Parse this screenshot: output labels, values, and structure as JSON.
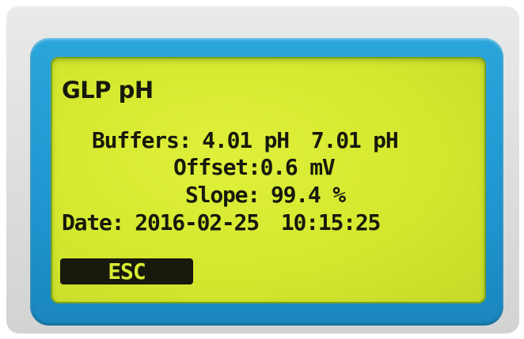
{
  "screen": {
    "title": "GLP pH",
    "buffers_label": "Buffers:",
    "buffer_1": "4.01 pH",
    "buffer_2": "7.01 pH",
    "offset_label": "Offset:",
    "offset_value": "0.6 mV",
    "slope_label": "Slope:",
    "slope_value": "99.4 %",
    "date_label": "Date:",
    "date_value": "2016-02-25",
    "time_value": "10:15:25"
  },
  "softkeys": {
    "esc_label": "ESC"
  },
  "colors": {
    "lcd_background": "#d4e82f",
    "lcd_text": "#17190c",
    "bezel": "#2aa6dc",
    "housing": "#dcdddd"
  }
}
